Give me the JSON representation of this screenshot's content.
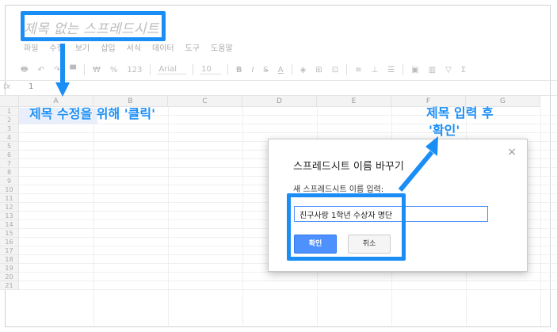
{
  "doc": {
    "title": "제목 없는 스프레드시트"
  },
  "menu": [
    "파일",
    "수정",
    "보기",
    "삽입",
    "서식",
    "데이터",
    "도구",
    "도움말"
  ],
  "toolbar": {
    "dollar": "₩",
    "percent": "%",
    "number_format": "123",
    "font": "Arial",
    "font_size": "10",
    "bold": "B",
    "italic": "I",
    "strike": "S",
    "text_color": "A",
    "sigma": "Σ"
  },
  "formula": {
    "fx": "fx",
    "value": "1"
  },
  "grid": {
    "columns": [
      "A",
      "B",
      "C",
      "D",
      "E",
      "F",
      "G"
    ],
    "rows": [
      "1",
      "2",
      "3",
      "4",
      "5",
      "6",
      "7",
      "8",
      "9",
      "10",
      "11",
      "12",
      "13",
      "14",
      "15",
      "16",
      "17",
      "18",
      "19",
      "20",
      "21"
    ]
  },
  "annotations": {
    "left": "제목 수정을 위해 '클릭'",
    "right_line1": "제목 입력 후",
    "right_line2": "'확인'",
    "color": "#1b8ef5"
  },
  "dialog": {
    "title": "스프레드시트 이름 바꾸기",
    "close": "×",
    "label": "새 스프레드시트 이름 입력:",
    "input_value": "친구사랑 1학년 수상자 명단",
    "ok_label": "확인",
    "cancel_label": "취소"
  }
}
